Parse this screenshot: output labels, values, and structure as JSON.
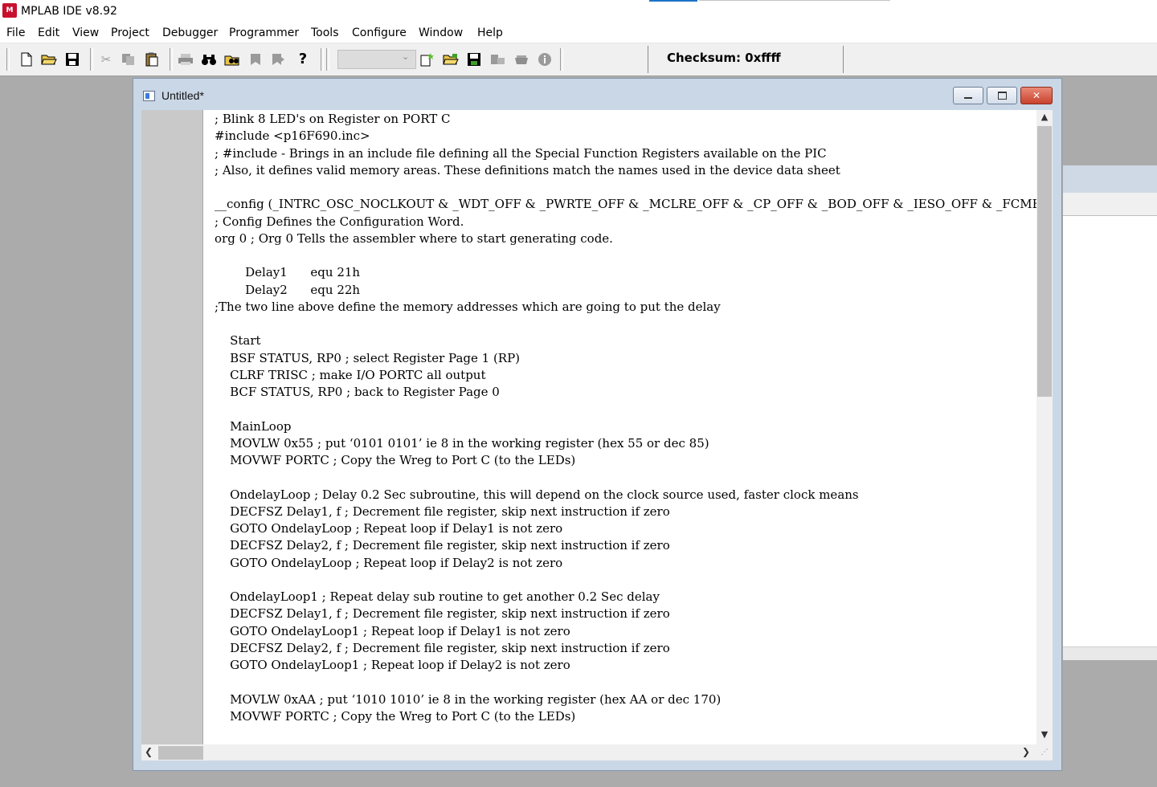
{
  "app": {
    "title": "MPLAB IDE v8.92",
    "icon_label": "M"
  },
  "menu": [
    "File",
    "Edit",
    "View",
    "Project",
    "Debugger",
    "Programmer",
    "Tools",
    "Configure",
    "Window",
    "Help"
  ],
  "toolbar": {
    "icons": {
      "new": "new-file-icon",
      "open": "open-folder-icon",
      "save": "save-disk-icon",
      "cut": "scissors-icon",
      "copy": "copy-icon",
      "paste": "clipboard-icon",
      "print": "printer-icon",
      "find": "binoculars-icon",
      "find_files": "find-in-files-icon",
      "bookmark_prev": "bookmark-left-icon",
      "bookmark_next": "bookmark-right-icon",
      "help": "question-mark-icon",
      "new_project": "new-project-icon",
      "open_project": "open-project-icon",
      "save_project": "save-project-icon",
      "build": "build-icon",
      "make": "make-icon",
      "info": "info-icon"
    },
    "build_config_value": "",
    "checksum": "Checksum:  0xffff"
  },
  "editor": {
    "title": "Untitled*",
    "code_lines": [
      "; Blink 8 LED's on Register on PORT C",
      "#include <p16F690.inc>",
      "; #include - Brings in an include file defining all the Special Function Registers available on the PIC",
      "; Also, it defines valid memory areas. These definitions match the names used in the device data sheet",
      "",
      "__config (_INTRC_OSC_NOCLKOUT & _WDT_OFF & _PWRTE_OFF & _MCLRE_OFF & _CP_OFF & _BOD_OFF & _IESO_OFF & _FCMEN_OFF)",
      "; Config Defines the Configuration Word.",
      "org 0 ; Org 0 Tells the assembler where to start generating code.",
      "",
      "        Delay1      equ 21h",
      "        Delay2      equ 22h",
      ";The two line above define the memory addresses which are going to put the delay",
      "",
      "    Start",
      "    BSF STATUS, RP0 ; select Register Page 1 (RP)",
      "    CLRF TRISC ; make I/O PORTC all output",
      "    BCF STATUS, RP0 ; back to Register Page 0",
      "",
      "    MainLoop",
      "    MOVLW 0x55 ; put ‘0101 0101’ ie 8 in the working register (hex 55 or dec 85)",
      "    MOVWF PORTC ; Copy the Wreg to Port C (to the LEDs)",
      "",
      "    OndelayLoop ; Delay 0.2 Sec subroutine, this will depend on the clock source used, faster clock means",
      "    DECFSZ Delay1, f ; Decrement file register, skip next instruction if zero",
      "    GOTO OndelayLoop ; Repeat loop if Delay1 is not zero",
      "    DECFSZ Delay2, f ; Decrement file register, skip next instruction if zero",
      "    GOTO OndelayLoop ; Repeat loop if Delay2 is not zero",
      "",
      "    OndelayLoop1 ; Repeat delay sub routine to get another 0.2 Sec delay",
      "    DECFSZ Delay1, f ; Decrement file register, skip next instruction if zero",
      "    GOTO OndelayLoop1 ; Repeat loop if Delay1 is not zero",
      "    DECFSZ Delay2, f ; Decrement file register, skip next instruction if zero",
      "    GOTO OndelayLoop1 ; Repeat loop if Delay2 is not zero",
      "",
      "    MOVLW 0xAA ; put ‘1010 1010’ ie 8 in the working register (hex AA or dec 170)",
      "    MOVWF PORTC ; Copy the Wreg to Port C (to the LEDs)"
    ]
  },
  "colors": {
    "titlebar": "#ffffff",
    "mdi_background": "#ababab",
    "window_frame": "#cad7e6",
    "close_button": "#c8412c",
    "gutter": "#c9c9c9"
  }
}
